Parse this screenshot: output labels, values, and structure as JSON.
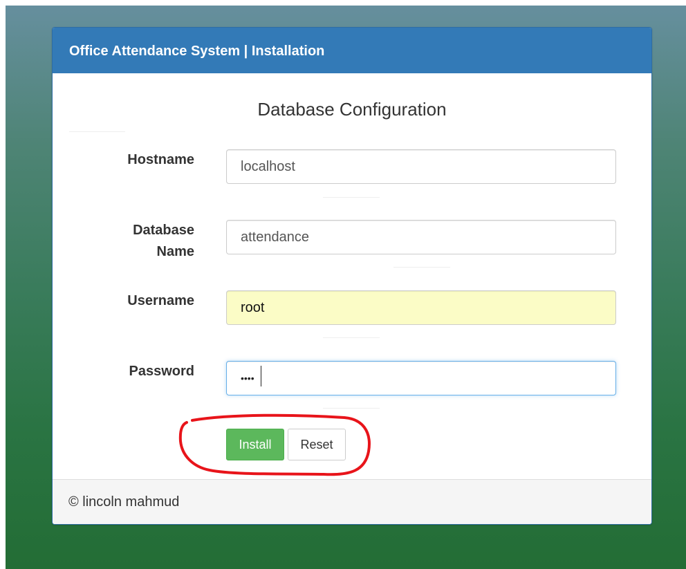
{
  "header": {
    "title": "Office Attendance System | Installation"
  },
  "form": {
    "section_title": "Database Configuration",
    "fields": [
      {
        "label": "Hostname",
        "value": "localhost"
      },
      {
        "label_line1": "Database",
        "label_line2": "Name",
        "value": "attendance"
      },
      {
        "label": "Username",
        "value": "root"
      },
      {
        "label": "Password",
        "value": "••••"
      }
    ],
    "install_label": "Install",
    "reset_label": "Reset"
  },
  "footer": {
    "text": "© lincoln mahmud"
  },
  "colors": {
    "header_bg": "#337ab7",
    "install_bg": "#5cb85c",
    "autofill_bg": "#fbfcc6",
    "annotation": "#e8141a"
  }
}
